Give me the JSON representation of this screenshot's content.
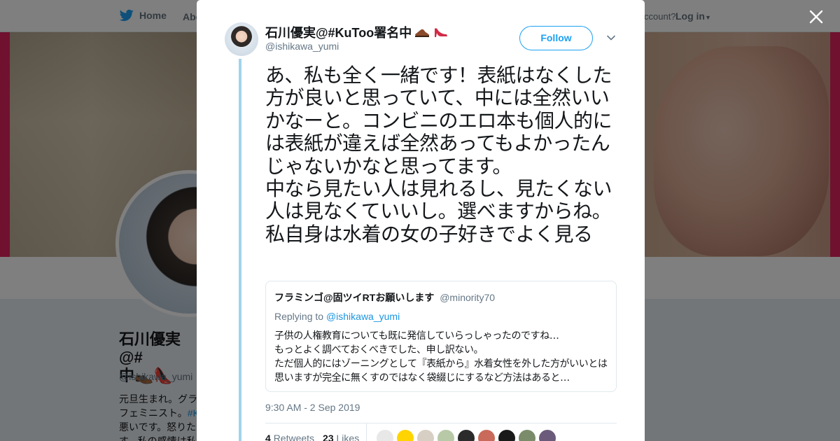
{
  "nav": {
    "home_label": "Home",
    "about_label": "Abo",
    "account_prompt": "ccount?",
    "login_label": "Log in"
  },
  "profile": {
    "name": "石川優実@#\n中",
    "handle": "@ishikawa_yumi",
    "bio_line1": "元旦生まれ。グラ",
    "bio_line2_prefix": "フェミニスト。",
    "bio_line2_tag": "#K",
    "bio_line3": "悪いです。怒りた",
    "bio_line4": "す。私の感情は私"
  },
  "tweet": {
    "display_name": "石川優実@#KuToo署名中",
    "handle": "@ishikawa_yumi",
    "follow_label": "Follow",
    "text": "あ、私も全く一緒です！表紙はなくした方が良いと思っていて、中には全然いいかなーと。コンビニのエロ本も個人的には表紙が違えば全然あってもよかったんじゃないかなと思ってます。\n中なら見たい人は見れるし、見たくない人は見なくていいし。選べますからね。私自身は水着の女の子好きでよく見る",
    "timestamp": "9:30 AM - 2 Sep 2019",
    "retweets_count": "4",
    "retweets_label": "Retweets",
    "likes_count": "23",
    "likes_label": "Likes"
  },
  "quote": {
    "name": "フラミンゴ@固ツイRTお願いします",
    "handle": "@minority70",
    "replying_prefix": "Replying to",
    "replying_to": "@ishikawa_yumi",
    "line1": "子供の人権教育についても既に発信していらっしゃったのですね…",
    "line2": "もっとよく調べておくべきでした、申し訳ない。",
    "line3": "ただ個人的にはゾーニングとして『表紙から』水着女性を外した方がいいとは思いますが完全に無くすのではなく袋綴じにするなど方法はあると…"
  },
  "likers": {
    "colors": [
      "#e8e8e8",
      "#ffd400",
      "#d8cfc4",
      "#b8c9a8",
      "#2b2b2b",
      "#c96a5a",
      "#1a1a1a",
      "#7a8c6a",
      "#6b5a7a"
    ]
  },
  "colors": {
    "brand_blue": "#1da1f2",
    "banner_red": "#e0245e",
    "thread_line": "#a2d3ea"
  }
}
